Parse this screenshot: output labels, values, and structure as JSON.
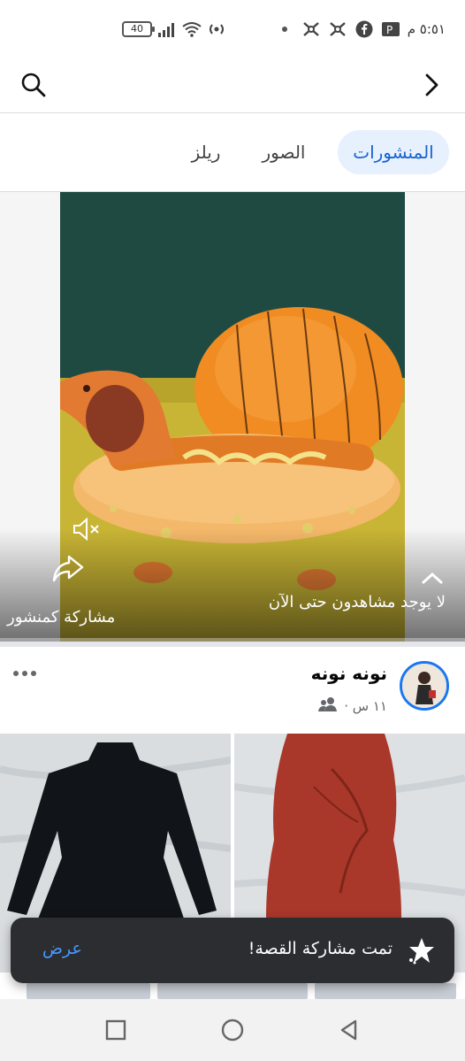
{
  "status_bar": {
    "time": "٥:٥١ م",
    "battery": "40",
    "icons": [
      "battery-icon",
      "signal-icon",
      "wifi-icon",
      "hotspot-icon",
      "dot-icon",
      "app-icon",
      "app-icon",
      "facebook-icon",
      "parking-icon"
    ]
  },
  "top_bar": {
    "search_icon": "search-icon",
    "back_icon": "chevron-right-icon"
  },
  "tabs": [
    {
      "label": "المنشورات",
      "active": true
    },
    {
      "label": "الصور",
      "active": false
    },
    {
      "label": "ريلز",
      "active": false
    }
  ],
  "media_post": {
    "viewers_text": "لا يوجد مشاهدون حتى الآن",
    "share_text": "مشاركة كمنشور",
    "mute_icon": "speaker-muted-icon",
    "share_icon": "share-arrow-icon"
  },
  "author": {
    "name": "نونه نونه",
    "time": "١١ س ·",
    "audience_icon": "friends-icon",
    "more_icon": "more-dots-icon"
  },
  "snackbar": {
    "message": "تمت مشاركة القصة!",
    "action": "عرض",
    "icon": "sparkle-icon"
  },
  "nav_bar": {
    "recents_icon": "square-icon",
    "home_icon": "circle-icon",
    "back_icon": "triangle-back-icon"
  },
  "colors": {
    "accent": "#1763cf",
    "tab_active_bg": "#e7f0fd",
    "snackbar_bg": "#2b2d30",
    "snackbar_action": "#4599ff"
  }
}
